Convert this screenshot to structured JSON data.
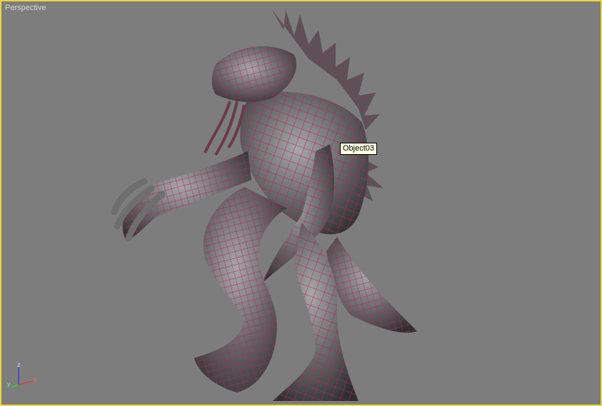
{
  "viewport": {
    "label": "Perspective",
    "border_color": "#e8d83a",
    "background_color": "#7d7d7d",
    "wire_color": "#b8245e"
  },
  "tooltip": {
    "text": "Object03"
  },
  "axis_gizmo": {
    "x_label": "x",
    "y_label": "y",
    "z_label": "z"
  },
  "scene": {
    "model_name": "Object03"
  }
}
